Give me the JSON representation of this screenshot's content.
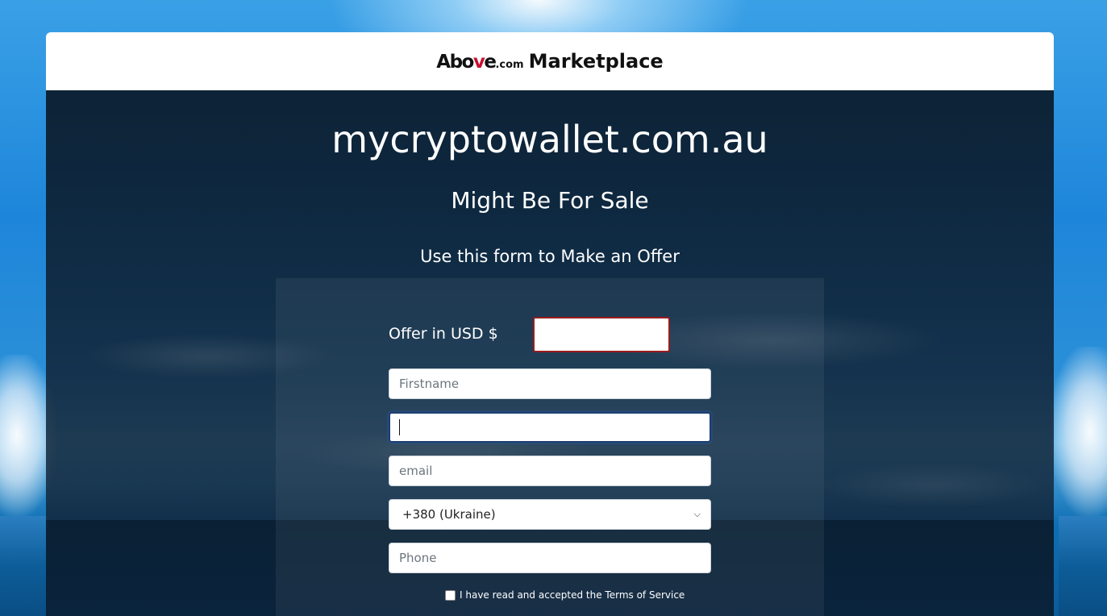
{
  "header": {
    "brand_above": "Abo",
    "brand_v": "v",
    "brand_e": "e",
    "brand_dotcom": ".com",
    "brand_marketplace": "Marketplace"
  },
  "main": {
    "domain": "mycryptowallet.com.au",
    "sale_text": "Might Be For Sale",
    "form_intro": "Use this form to Make an Offer"
  },
  "form": {
    "offer_label": "Offer in USD $",
    "offer_value": "",
    "firstname_placeholder": "Firstname",
    "lastname_value": "",
    "email_placeholder": "email",
    "country_code_selected": "+380 (Ukraine)",
    "phone_placeholder": "Phone",
    "terms_label": "I have read and accepted the Terms of Service",
    "terms_checked": false
  },
  "colors": {
    "brand_accent": "#c8102e",
    "offer_border": "#9b1c1c",
    "focus_border": "#1d3f73"
  }
}
